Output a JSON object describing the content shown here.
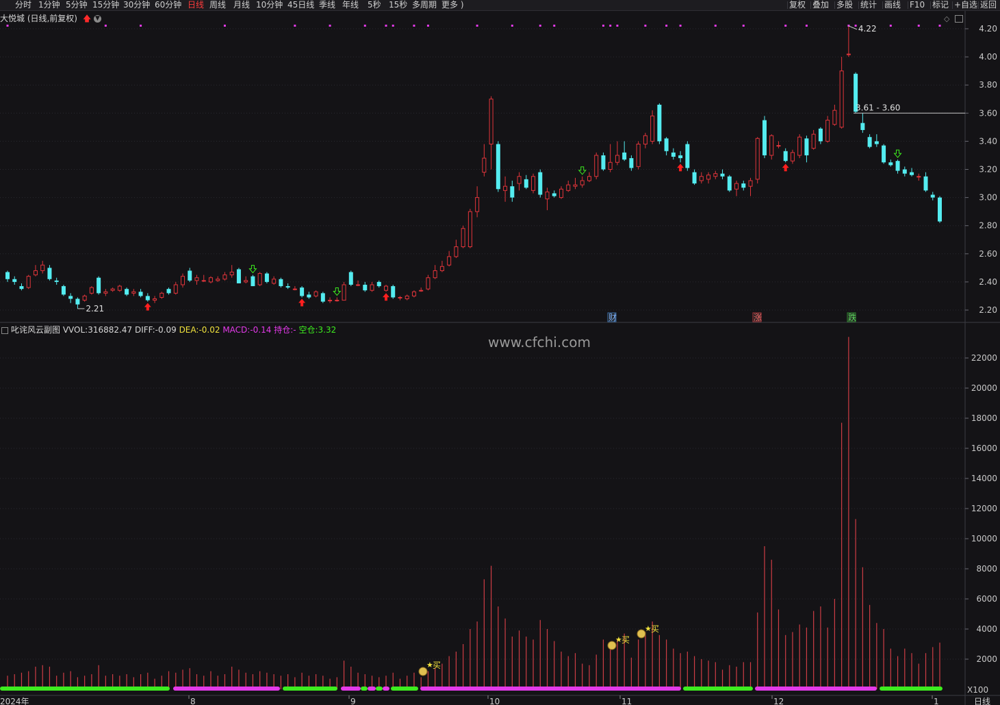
{
  "topbar": {
    "tabs": [
      "分时",
      "1分钟",
      "5分钟",
      "15分钟",
      "30分钟",
      "60分钟",
      "日线",
      "周线",
      "月线",
      "10分钟",
      "45日线",
      "季线",
      "年线",
      "5秒",
      "15秒",
      "多周期",
      "更多 )"
    ],
    "active_tab": "日线",
    "right_buttons": [
      "复权",
      "叠加",
      "多股",
      "统计",
      "画线",
      "F10",
      "标记",
      "+自选",
      "返回"
    ]
  },
  "header": {
    "stock_title": "大悦城 (日线,前复权)"
  },
  "price_axis": {
    "ticks": [
      "4.20",
      "4.00",
      "3.80",
      "3.60",
      "3.40",
      "3.20",
      "3.00",
      "2.80",
      "2.60",
      "2.40",
      "2.20"
    ]
  },
  "annotations": {
    "high_label": "4.22",
    "low_label": "2.21",
    "hline_label": "3.61 - 3.60",
    "event_tags": [
      "财",
      "涨",
      "跌"
    ],
    "buy_label": "买"
  },
  "indicator": {
    "name": "叱诧风云副图",
    "vvol_label": "VVOL:",
    "vvol_value": "316882.47",
    "diff_label": "DIFF:",
    "diff_value": "-0.09",
    "dea_label": "DEA:",
    "dea_value": "-0.02",
    "macd_label": "MACD:",
    "macd_value": "-0.14",
    "hold_label": "持仓:",
    "hold_value": "-",
    "empty_label": "空仓:",
    "empty_value": "3.32"
  },
  "watermark": "www.cfchi.com",
  "volume_axis": {
    "ticks": [
      "22000",
      "20000",
      "18000",
      "16000",
      "14000",
      "12000",
      "10000",
      "8000",
      "6000",
      "4000",
      "2000"
    ],
    "unit": "X100"
  },
  "time_axis": {
    "labels": [
      "2024年",
      "8",
      "9",
      "10",
      "11",
      "12",
      "1"
    ],
    "period_button": "日线"
  },
  "colors": {
    "up": "#e2353b",
    "down": "#54ecf0",
    "magenta": "#e33ae9",
    "green": "#3ded1f",
    "yellow": "#f0e23c",
    "volume": "#cf3d45",
    "background": "#141316"
  },
  "chart_data": {
    "type": "candlestick",
    "date_range": [
      "2024-07",
      "2025-01"
    ],
    "price_ylim": [
      2.15,
      4.25
    ],
    "volume_ylim": [
      0,
      23500
    ],
    "candles": [
      {
        "o": 2.47,
        "c": 2.42,
        "h": 2.48,
        "l": 2.4,
        "v": 900
      },
      {
        "o": 2.42,
        "c": 2.4,
        "h": 2.44,
        "l": 2.38,
        "v": 1000
      },
      {
        "o": 2.37,
        "c": 2.35,
        "h": 2.39,
        "l": 2.34,
        "v": 1100
      },
      {
        "o": 2.36,
        "c": 2.44,
        "h": 2.45,
        "l": 2.35,
        "v": 1200
      },
      {
        "o": 2.45,
        "c": 2.48,
        "h": 2.52,
        "l": 2.44,
        "v": 1500
      },
      {
        "o": 2.48,
        "c": 2.52,
        "h": 2.55,
        "l": 2.46,
        "v": 1600
      },
      {
        "o": 2.5,
        "c": 2.42,
        "h": 2.52,
        "l": 2.41,
        "v": 1500
      },
      {
        "o": 2.41,
        "c": 2.4,
        "h": 2.43,
        "l": 2.38,
        "v": 900
      },
      {
        "o": 2.37,
        "c": 2.31,
        "h": 2.38,
        "l": 2.3,
        "v": 1100
      },
      {
        "o": 2.3,
        "c": 2.28,
        "h": 2.32,
        "l": 2.25,
        "v": 1200
      },
      {
        "o": 2.28,
        "c": 2.24,
        "h": 2.29,
        "l": 2.21,
        "v": 800
      },
      {
        "o": 2.27,
        "c": 2.3,
        "h": 2.31,
        "l": 2.26,
        "v": 900
      },
      {
        "o": 2.32,
        "c": 2.36,
        "h": 2.37,
        "l": 2.31,
        "v": 1000
      },
      {
        "o": 2.43,
        "c": 2.32,
        "h": 2.44,
        "l": 2.31,
        "v": 1600
      },
      {
        "o": 2.32,
        "c": 2.33,
        "h": 2.35,
        "l": 2.3,
        "v": 900
      },
      {
        "o": 2.34,
        "c": 2.35,
        "h": 2.36,
        "l": 2.33,
        "v": 1000
      },
      {
        "o": 2.34,
        "c": 2.37,
        "h": 2.38,
        "l": 2.33,
        "v": 900
      },
      {
        "o": 2.35,
        "c": 2.31,
        "h": 2.36,
        "l": 2.3,
        "v": 1000
      },
      {
        "o": 2.32,
        "c": 2.33,
        "h": 2.35,
        "l": 2.3,
        "v": 800
      },
      {
        "o": 2.33,
        "c": 2.3,
        "h": 2.35,
        "l": 2.29,
        "v": 1000
      },
      {
        "o": 2.3,
        "c": 2.27,
        "h": 2.32,
        "l": 2.26,
        "v": 1100
      },
      {
        "o": 2.27,
        "c": 2.28,
        "h": 2.3,
        "l": 2.25,
        "v": 700
      },
      {
        "o": 2.29,
        "c": 2.32,
        "h": 2.33,
        "l": 2.28,
        "v": 900
      },
      {
        "o": 2.35,
        "c": 2.32,
        "h": 2.36,
        "l": 2.31,
        "v": 1200
      },
      {
        "o": 2.32,
        "c": 2.38,
        "h": 2.4,
        "l": 2.31,
        "v": 1100
      },
      {
        "o": 2.38,
        "c": 2.44,
        "h": 2.46,
        "l": 2.36,
        "v": 1300
      },
      {
        "o": 2.48,
        "c": 2.41,
        "h": 2.5,
        "l": 2.4,
        "v": 1400
      },
      {
        "o": 2.41,
        "c": 2.43,
        "h": 2.45,
        "l": 2.38,
        "v": 1000
      },
      {
        "o": 2.41,
        "c": 2.41,
        "h": 2.45,
        "l": 2.4,
        "v": 900
      },
      {
        "o": 2.4,
        "c": 2.43,
        "h": 2.44,
        "l": 2.39,
        "v": 1200
      },
      {
        "o": 2.41,
        "c": 2.42,
        "h": 2.44,
        "l": 2.4,
        "v": 900
      },
      {
        "o": 2.42,
        "c": 2.45,
        "h": 2.47,
        "l": 2.41,
        "v": 1000
      },
      {
        "o": 2.45,
        "c": 2.47,
        "h": 2.52,
        "l": 2.43,
        "v": 1500
      },
      {
        "o": 2.49,
        "c": 2.39,
        "h": 2.5,
        "l": 2.39,
        "v": 1300
      },
      {
        "o": 2.4,
        "c": 2.41,
        "h": 2.44,
        "l": 2.39,
        "v": 1100
      },
      {
        "o": 2.44,
        "c": 2.37,
        "h": 2.45,
        "l": 2.37,
        "v": 1000
      },
      {
        "o": 2.38,
        "c": 2.46,
        "h": 2.47,
        "l": 2.37,
        "v": 1200
      },
      {
        "o": 2.46,
        "c": 2.4,
        "h": 2.47,
        "l": 2.39,
        "v": 1100
      },
      {
        "o": 2.39,
        "c": 2.42,
        "h": 2.44,
        "l": 2.38,
        "v": 1000
      },
      {
        "o": 2.42,
        "c": 2.37,
        "h": 2.43,
        "l": 2.36,
        "v": 900
      },
      {
        "o": 2.37,
        "c": 2.36,
        "h": 2.39,
        "l": 2.35,
        "v": 1000
      },
      {
        "o": 2.35,
        "c": 2.35,
        "h": 2.37,
        "l": 2.34,
        "v": 800
      },
      {
        "o": 2.36,
        "c": 2.3,
        "h": 2.37,
        "l": 2.29,
        "v": 1100
      },
      {
        "o": 2.31,
        "c": 2.29,
        "h": 2.33,
        "l": 2.28,
        "v": 900
      },
      {
        "o": 2.3,
        "c": 2.33,
        "h": 2.34,
        "l": 2.29,
        "v": 1000
      },
      {
        "o": 2.32,
        "c": 2.26,
        "h": 2.33,
        "l": 2.25,
        "v": 900
      },
      {
        "o": 2.27,
        "c": 2.27,
        "h": 2.29,
        "l": 2.25,
        "v": 700
      },
      {
        "o": 2.27,
        "c": 2.27,
        "h": 2.29,
        "l": 2.26,
        "v": 800
      },
      {
        "o": 2.27,
        "c": 2.38,
        "h": 2.4,
        "l": 2.27,
        "v": 1900
      },
      {
        "o": 2.47,
        "c": 2.38,
        "h": 2.48,
        "l": 2.37,
        "v": 1500
      },
      {
        "o": 2.38,
        "c": 2.38,
        "h": 2.41,
        "l": 2.37,
        "v": 1100
      },
      {
        "o": 2.38,
        "c": 2.34,
        "h": 2.4,
        "l": 2.33,
        "v": 1000
      },
      {
        "o": 2.34,
        "c": 2.38,
        "h": 2.4,
        "l": 2.33,
        "v": 900
      },
      {
        "o": 2.4,
        "c": 2.37,
        "h": 2.41,
        "l": 2.36,
        "v": 800
      },
      {
        "o": 2.34,
        "c": 2.37,
        "h": 2.38,
        "l": 2.33,
        "v": 900
      },
      {
        "o": 2.37,
        "c": 2.29,
        "h": 2.38,
        "l": 2.28,
        "v": 1100
      },
      {
        "o": 2.29,
        "c": 2.29,
        "h": 2.3,
        "l": 2.27,
        "v": 700
      },
      {
        "o": 2.28,
        "c": 2.3,
        "h": 2.31,
        "l": 2.27,
        "v": 900
      },
      {
        "o": 2.3,
        "c": 2.33,
        "h": 2.34,
        "l": 2.29,
        "v": 1100
      },
      {
        "o": 2.34,
        "c": 2.34,
        "h": 2.36,
        "l": 2.33,
        "v": 800
      },
      {
        "o": 2.35,
        "c": 2.43,
        "h": 2.45,
        "l": 2.34,
        "v": 1200
      },
      {
        "o": 2.43,
        "c": 2.48,
        "h": 2.52,
        "l": 2.42,
        "v": 1400
      },
      {
        "o": 2.48,
        "c": 2.51,
        "h": 2.55,
        "l": 2.47,
        "v": 1700
      },
      {
        "o": 2.52,
        "c": 2.58,
        "h": 2.62,
        "l": 2.51,
        "v": 2200
      },
      {
        "o": 2.58,
        "c": 2.65,
        "h": 2.7,
        "l": 2.57,
        "v": 2500
      },
      {
        "o": 2.65,
        "c": 2.78,
        "h": 2.8,
        "l": 2.64,
        "v": 3000
      },
      {
        "o": 2.65,
        "c": 2.9,
        "h": 2.92,
        "l": 2.64,
        "v": 4000
      },
      {
        "o": 2.9,
        "c": 3.0,
        "h": 3.08,
        "l": 2.86,
        "v": 4500
      },
      {
        "o": 3.18,
        "c": 3.28,
        "h": 3.38,
        "l": 3.15,
        "v": 7300
      },
      {
        "o": 3.38,
        "c": 3.7,
        "h": 3.72,
        "l": 3.2,
        "v": 8200
      },
      {
        "o": 3.38,
        "c": 3.06,
        "h": 3.4,
        "l": 3.04,
        "v": 5500
      },
      {
        "o": 3.05,
        "c": 3.08,
        "h": 3.15,
        "l": 2.97,
        "v": 4700
      },
      {
        "o": 3.08,
        "c": 3.0,
        "h": 3.12,
        "l": 2.97,
        "v": 3500
      },
      {
        "o": 3.1,
        "c": 3.15,
        "h": 3.18,
        "l": 3.05,
        "v": 3900
      },
      {
        "o": 3.13,
        "c": 3.07,
        "h": 3.16,
        "l": 3.06,
        "v": 3500
      },
      {
        "o": 3.05,
        "c": 3.15,
        "h": 3.17,
        "l": 3.03,
        "v": 3300
      },
      {
        "o": 3.18,
        "c": 3.02,
        "h": 3.2,
        "l": 3.0,
        "v": 4600
      },
      {
        "o": 2.99,
        "c": 3.04,
        "h": 3.07,
        "l": 2.91,
        "v": 4000
      },
      {
        "o": 3.03,
        "c": 3.01,
        "h": 3.05,
        "l": 3.0,
        "v": 3200
      },
      {
        "o": 3.0,
        "c": 3.06,
        "h": 3.08,
        "l": 2.99,
        "v": 2500
      },
      {
        "o": 3.05,
        "c": 3.09,
        "h": 3.12,
        "l": 3.04,
        "v": 2200
      },
      {
        "o": 3.08,
        "c": 3.09,
        "h": 3.14,
        "l": 3.06,
        "v": 2400
      },
      {
        "o": 3.09,
        "c": 3.12,
        "h": 3.15,
        "l": 3.07,
        "v": 1700
      },
      {
        "o": 3.12,
        "c": 3.15,
        "h": 3.18,
        "l": 3.11,
        "v": 1600
      },
      {
        "o": 3.15,
        "c": 3.3,
        "h": 3.32,
        "l": 3.13,
        "v": 2300
      },
      {
        "o": 3.3,
        "c": 3.2,
        "h": 3.32,
        "l": 3.19,
        "v": 3300
      },
      {
        "o": 3.2,
        "c": 3.25,
        "h": 3.38,
        "l": 3.18,
        "v": 2800
      },
      {
        "o": 3.25,
        "c": 3.3,
        "h": 3.4,
        "l": 3.23,
        "v": 3300
      },
      {
        "o": 3.32,
        "c": 3.27,
        "h": 3.4,
        "l": 3.26,
        "v": 3700
      },
      {
        "o": 3.28,
        "c": 3.21,
        "h": 3.3,
        "l": 3.19,
        "v": 2100
      },
      {
        "o": 3.22,
        "c": 3.38,
        "h": 3.4,
        "l": 3.2,
        "v": 3300
      },
      {
        "o": 3.38,
        "c": 3.44,
        "h": 3.46,
        "l": 3.35,
        "v": 3800
      },
      {
        "o": 3.4,
        "c": 3.58,
        "h": 3.62,
        "l": 3.38,
        "v": 4500
      },
      {
        "o": 3.66,
        "c": 3.4,
        "h": 3.67,
        "l": 3.38,
        "v": 3600
      },
      {
        "o": 3.42,
        "c": 3.33,
        "h": 3.43,
        "l": 3.3,
        "v": 3300
      },
      {
        "o": 3.32,
        "c": 3.29,
        "h": 3.35,
        "l": 3.27,
        "v": 2700
      },
      {
        "o": 3.3,
        "c": 3.28,
        "h": 3.33,
        "l": 3.25,
        "v": 2400
      },
      {
        "o": 3.38,
        "c": 3.21,
        "h": 3.4,
        "l": 3.19,
        "v": 2500
      },
      {
        "o": 3.18,
        "c": 3.1,
        "h": 3.2,
        "l": 3.09,
        "v": 2200
      },
      {
        "o": 3.12,
        "c": 3.15,
        "h": 3.18,
        "l": 3.1,
        "v": 2000
      },
      {
        "o": 3.13,
        "c": 3.16,
        "h": 3.18,
        "l": 3.1,
        "v": 1900
      },
      {
        "o": 3.15,
        "c": 3.17,
        "h": 3.19,
        "l": 3.13,
        "v": 1800
      },
      {
        "o": 3.17,
        "c": 3.15,
        "h": 3.2,
        "l": 3.13,
        "v": 1300
      },
      {
        "o": 3.15,
        "c": 3.05,
        "h": 3.16,
        "l": 3.04,
        "v": 1600
      },
      {
        "o": 3.06,
        "c": 3.1,
        "h": 3.12,
        "l": 3.01,
        "v": 1500
      },
      {
        "o": 3.1,
        "c": 3.07,
        "h": 3.12,
        "l": 3.05,
        "v": 1800
      },
      {
        "o": 3.08,
        "c": 3.12,
        "h": 3.14,
        "l": 3.01,
        "v": 1800
      },
      {
        "o": 3.13,
        "c": 3.42,
        "h": 3.43,
        "l": 3.1,
        "v": 5100
      },
      {
        "o": 3.55,
        "c": 3.3,
        "h": 3.58,
        "l": 3.28,
        "v": 9500
      },
      {
        "o": 3.3,
        "c": 3.44,
        "h": 3.45,
        "l": 3.27,
        "v": 8600
      },
      {
        "o": 3.37,
        "c": 3.37,
        "h": 3.4,
        "l": 3.35,
        "v": 5300
      },
      {
        "o": 3.33,
        "c": 3.26,
        "h": 3.35,
        "l": 3.25,
        "v": 3600
      },
      {
        "o": 3.26,
        "c": 3.32,
        "h": 3.34,
        "l": 3.24,
        "v": 3800
      },
      {
        "o": 3.3,
        "c": 3.43,
        "h": 3.45,
        "l": 3.28,
        "v": 4300
      },
      {
        "o": 3.42,
        "c": 3.3,
        "h": 3.44,
        "l": 3.25,
        "v": 4100
      },
      {
        "o": 3.35,
        "c": 3.45,
        "h": 3.48,
        "l": 3.34,
        "v": 5200
      },
      {
        "o": 3.49,
        "c": 3.4,
        "h": 3.5,
        "l": 3.38,
        "v": 5500
      },
      {
        "o": 3.4,
        "c": 3.55,
        "h": 3.58,
        "l": 3.39,
        "v": 4100
      },
      {
        "o": 3.52,
        "c": 3.62,
        "h": 3.66,
        "l": 3.51,
        "v": 6000
      },
      {
        "o": 3.5,
        "c": 3.9,
        "h": 4.0,
        "l": 3.49,
        "v": 17700
      },
      {
        "o": 4.02,
        "c": 4.02,
        "h": 4.22,
        "l": 4.0,
        "v": 23400
      },
      {
        "o": 3.88,
        "c": 3.61,
        "h": 3.89,
        "l": 3.6,
        "v": 11300
      },
      {
        "o": 3.53,
        "c": 3.48,
        "h": 3.6,
        "l": 3.46,
        "v": 8100
      },
      {
        "o": 3.43,
        "c": 3.36,
        "h": 3.45,
        "l": 3.35,
        "v": 5600
      },
      {
        "o": 3.4,
        "c": 3.38,
        "h": 3.45,
        "l": 3.36,
        "v": 4400
      },
      {
        "o": 3.37,
        "c": 3.25,
        "h": 3.38,
        "l": 3.24,
        "v": 4000
      },
      {
        "o": 3.25,
        "c": 3.23,
        "h": 3.27,
        "l": 3.22,
        "v": 2700
      },
      {
        "o": 3.26,
        "c": 3.19,
        "h": 3.27,
        "l": 3.17,
        "v": 2200
      },
      {
        "o": 3.2,
        "c": 3.17,
        "h": 3.22,
        "l": 3.15,
        "v": 2700
      },
      {
        "o": 3.18,
        "c": 3.16,
        "h": 3.21,
        "l": 3.15,
        "v": 2400
      },
      {
        "o": 3.15,
        "c": 3.15,
        "h": 3.17,
        "l": 3.12,
        "v": 1700
      },
      {
        "o": 3.15,
        "c": 3.05,
        "h": 3.18,
        "l": 3.04,
        "v": 2400
      },
      {
        "o": 3.02,
        "c": 3.0,
        "h": 3.04,
        "l": 2.98,
        "v": 2800
      },
      {
        "o": 3.0,
        "c": 2.83,
        "h": 3.01,
        "l": 2.82,
        "v": 3100
      }
    ],
    "annotations": {
      "high": 4.22,
      "low": 2.21,
      "hline": 3.6
    }
  }
}
